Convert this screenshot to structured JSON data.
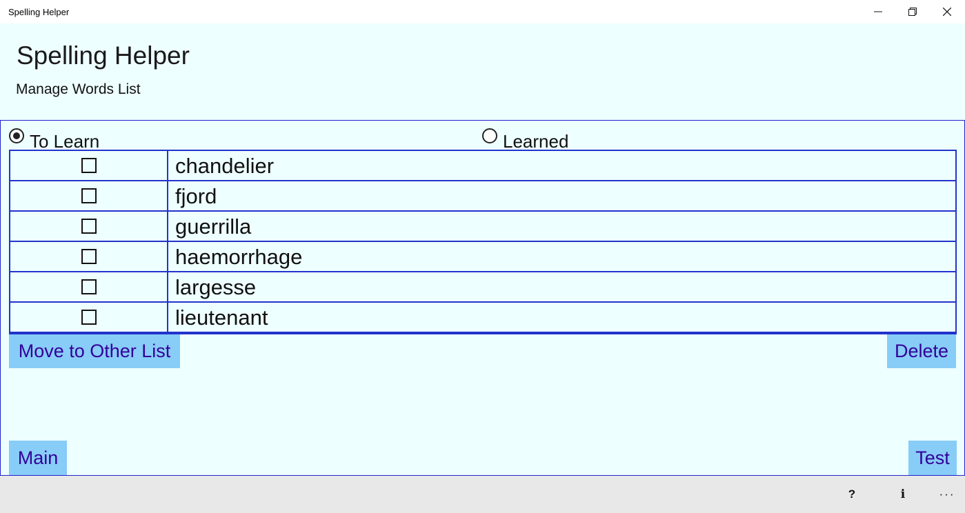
{
  "window": {
    "title": "Spelling Helper",
    "controls": {
      "minimize_icon": "minimize-icon",
      "restore_icon": "restore-icon",
      "close_icon": "close-icon"
    }
  },
  "header": {
    "app_title": "Spelling Helper",
    "page_title": "Manage Words List"
  },
  "filter": {
    "options": [
      {
        "label": "To Learn",
        "selected": true
      },
      {
        "label": "Learned",
        "selected": false
      }
    ]
  },
  "words": [
    {
      "word": "chandelier",
      "checked": false
    },
    {
      "word": "fjord",
      "checked": false
    },
    {
      "word": "guerrilla",
      "checked": false
    },
    {
      "word": "haemorrhage",
      "checked": false
    },
    {
      "word": "largesse",
      "checked": false
    },
    {
      "word": "lieutenant",
      "checked": false
    }
  ],
  "actions": {
    "move_label": "Move to Other List",
    "delete_label": "Delete",
    "main_label": "Main",
    "test_label": "Test"
  },
  "appbar": {
    "help_label": "?",
    "info_label": "i",
    "more_label": "···"
  },
  "colors": {
    "background": "#eeffff",
    "border": "#2233cc",
    "button_bg": "#88ccf8",
    "button_text": "#330099",
    "appbar_bg": "#e8e8e8"
  }
}
